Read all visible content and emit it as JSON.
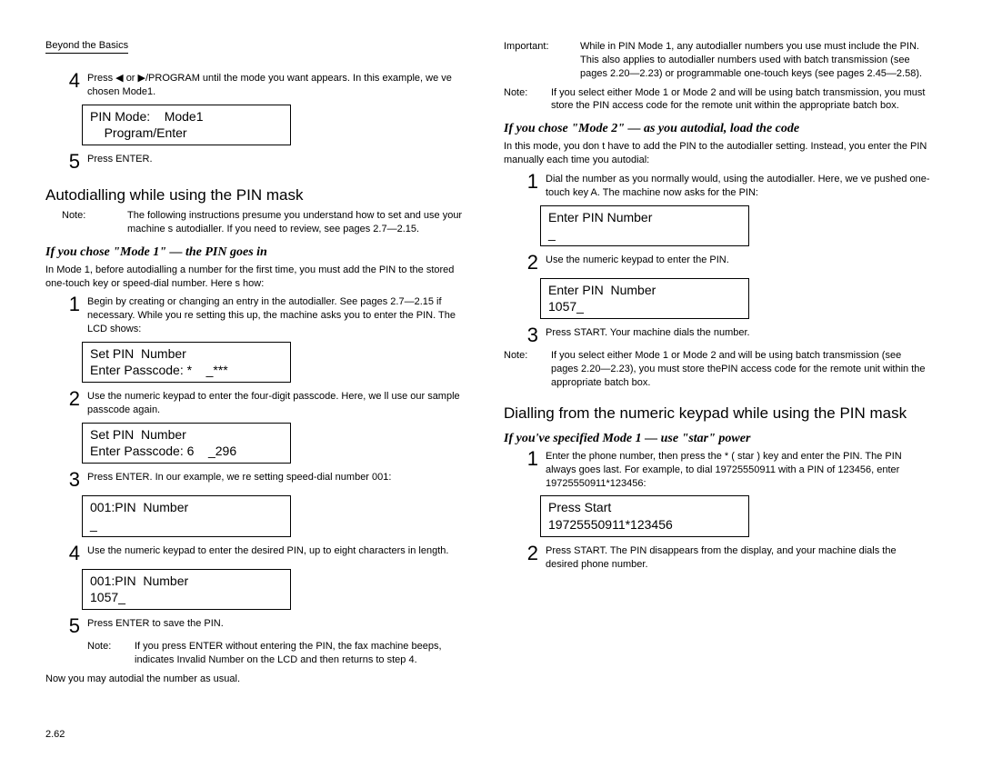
{
  "header": "Beyond the Basics",
  "left": {
    "step4a": {
      "n": "4",
      "t": "Press ◀ or ▶/PROGRAM until the mode you want appears. In this example, we ve chosen Mode1."
    },
    "lcd1": "PIN Mode:    Mode1\n    Program/Enter",
    "step5a": {
      "n": "5",
      "t": "Press ENTER."
    },
    "heading1": "Autodialling while using the PIN mask",
    "note1": {
      "label": "Note:",
      "body": "The following instructions presume you understand how to set and use your machine s autodialler. If you need to review, see pages 2.7—2.15."
    },
    "sub1": "If you chose \"Mode 1\" — the PIN goes in",
    "body1": "In Mode 1, before autodialling a number for the first time, you must add the PIN to the stored one-touch key or speed-dial number. Here s how:",
    "step1": {
      "n": "1",
      "t": "Begin by creating or changing an entry in the autodialler. See pages 2.7—2.15 if necessary. While you re setting this up, the machine asks you to enter the PIN. The LCD shows:"
    },
    "lcd2": "Set PIN  Number\nEnter Passcode: *    _***",
    "step2": {
      "n": "2",
      "t": "Use the numeric keypad to enter the four-digit passcode. Here, we ll use our sample passcode again."
    },
    "lcd3": "Set PIN  Number\nEnter Passcode: 6    _296",
    "step3": {
      "n": "3",
      "t": "Press ENTER. In our example, we re setting speed-dial number 001:"
    },
    "lcd4": "001:PIN  Number\n_",
    "step4": {
      "n": "4",
      "t": "Use the numeric keypad to enter the desired PIN, up to eight characters in length."
    },
    "lcd5": "001:PIN  Number\n1057_",
    "step5": {
      "n": "5",
      "t": "Press ENTER to save the PIN."
    },
    "note2": {
      "label": "Note:",
      "body": "If you press ENTER without entering the PIN, the fax machine beeps, indicates Invalid Number on the LCD and then returns to step 4."
    },
    "body2": "Now you may autodial the number as usual."
  },
  "right": {
    "imp": {
      "label": "Important:",
      "body": "While in PIN Mode 1, any autodialler numbers you use must include the PIN. This also applies to autodialler numbers used with batch transmission (see pages 2.20—2.23) or programmable one-touch keys (see pages 2.45—2.58)."
    },
    "note1": {
      "label": "Note:",
      "body": "If you select either Mode 1 or Mode 2 and will be using batch transmission, you must store the PIN access code for the remote unit within the appropriate batch box."
    },
    "sub1": "If you chose \"Mode 2\" — as you autodial, load the code",
    "body1": "In this mode, you don t have to add the PIN to the autodialler setting. Instead, you enter the PIN manually each time you autodial:",
    "step1": {
      "n": "1",
      "t": "Dial the number as you normally would, using the autodialler. Here, we ve pushed one-touch key A. The machine now asks for the PIN:"
    },
    "lcd1": "Enter PIN Number\n_",
    "step2": {
      "n": "2",
      "t": "Use the numeric keypad to enter the PIN."
    },
    "lcd2": "Enter PIN  Number\n1057_",
    "step3": {
      "n": "3",
      "t": "Press START. Your machine dials the number."
    },
    "note2": {
      "label": "Note:",
      "body": "If you select either Mode 1 or Mode 2 and will be using batch transmission (see pages 2.20—2.23), you must store thePIN access code for the remote unit within the appropriate batch box."
    },
    "heading2": "Dialling from the numeric keypad while using the PIN mask",
    "sub2": "If you've specified Mode 1 — use \"star\" power",
    "step1b": {
      "n": "1",
      "t": "Enter the phone number, then press the * ( star ) key and enter the PIN. The PIN always goes last. For example, to dial 19725550911 with a PIN of 123456, enter 19725550911*123456:"
    },
    "lcd3": "Press Start\n19725550911*123456",
    "step2b": {
      "n": "2",
      "t": "Press START. The PIN disappears from the display, and your machine dials the desired phone number."
    }
  },
  "pagenum": "2.62"
}
